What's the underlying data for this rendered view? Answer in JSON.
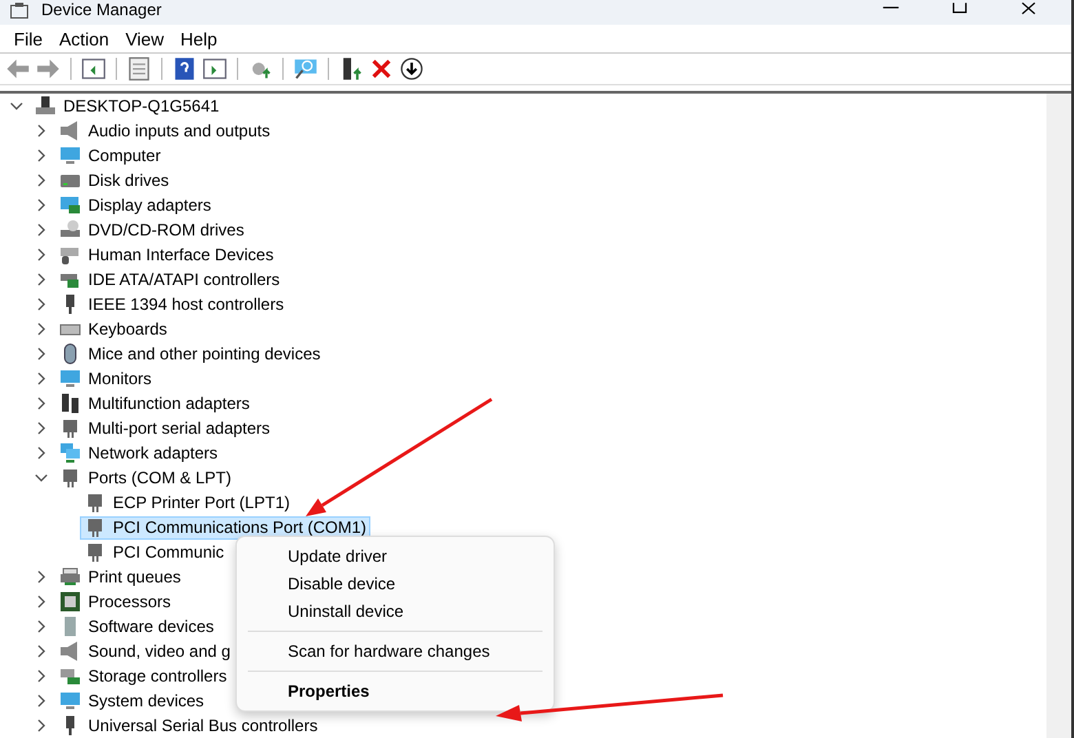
{
  "window": {
    "title": "Device Manager"
  },
  "menu_bar": [
    "File",
    "Action",
    "View",
    "Help"
  ],
  "tree": {
    "label": "DESKTOP-Q1G5641",
    "expanded": true,
    "selected": false,
    "children": [
      {
        "label": "Audio inputs and outputs",
        "expanded": false,
        "selected": false
      },
      {
        "label": "Computer",
        "expanded": false,
        "selected": false
      },
      {
        "label": "Disk drives",
        "expanded": false,
        "selected": false
      },
      {
        "label": "Display adapters",
        "expanded": false,
        "selected": false
      },
      {
        "label": "DVD/CD-ROM drives",
        "expanded": false,
        "selected": false
      },
      {
        "label": "Human Interface Devices",
        "expanded": false,
        "selected": false
      },
      {
        "label": "IDE ATA/ATAPI controllers",
        "expanded": false,
        "selected": false
      },
      {
        "label": "IEEE 1394 host controllers",
        "expanded": false,
        "selected": false
      },
      {
        "label": "Keyboards",
        "expanded": false,
        "selected": false
      },
      {
        "label": "Mice and other pointing devices",
        "expanded": false,
        "selected": false
      },
      {
        "label": "Monitors",
        "expanded": false,
        "selected": false
      },
      {
        "label": "Multifunction adapters",
        "expanded": false,
        "selected": false
      },
      {
        "label": "Multi-port serial adapters",
        "expanded": false,
        "selected": false
      },
      {
        "label": "Network adapters",
        "expanded": false,
        "selected": false
      },
      {
        "label": "Ports (COM & LPT)",
        "expanded": true,
        "selected": false,
        "children": [
          {
            "label": "ECP Printer Port (LPT1)",
            "selected": false
          },
          {
            "label": "PCI Communications Port (COM1)",
            "selected": true
          },
          {
            "label": "PCI Communic",
            "selected": false
          }
        ]
      },
      {
        "label": "Print queues",
        "expanded": false,
        "selected": false
      },
      {
        "label": "Processors",
        "expanded": false,
        "selected": false
      },
      {
        "label": "Software devices",
        "expanded": false,
        "selected": false
      },
      {
        "label": "Sound, video and g",
        "expanded": false,
        "selected": false
      },
      {
        "label": "Storage controllers",
        "expanded": false,
        "selected": false
      },
      {
        "label": "System devices",
        "expanded": false,
        "selected": false
      },
      {
        "label": "Universal Serial Bus controllers",
        "expanded": false,
        "selected": false
      }
    ]
  },
  "context_menu": {
    "groups": [
      [
        {
          "label": "Update driver",
          "default": false
        },
        {
          "label": "Disable device",
          "default": false
        },
        {
          "label": "Uninstall device",
          "default": false
        }
      ],
      [
        {
          "label": "Scan for hardware changes",
          "default": false
        }
      ],
      [
        {
          "label": "Properties",
          "default": true
        }
      ]
    ]
  }
}
